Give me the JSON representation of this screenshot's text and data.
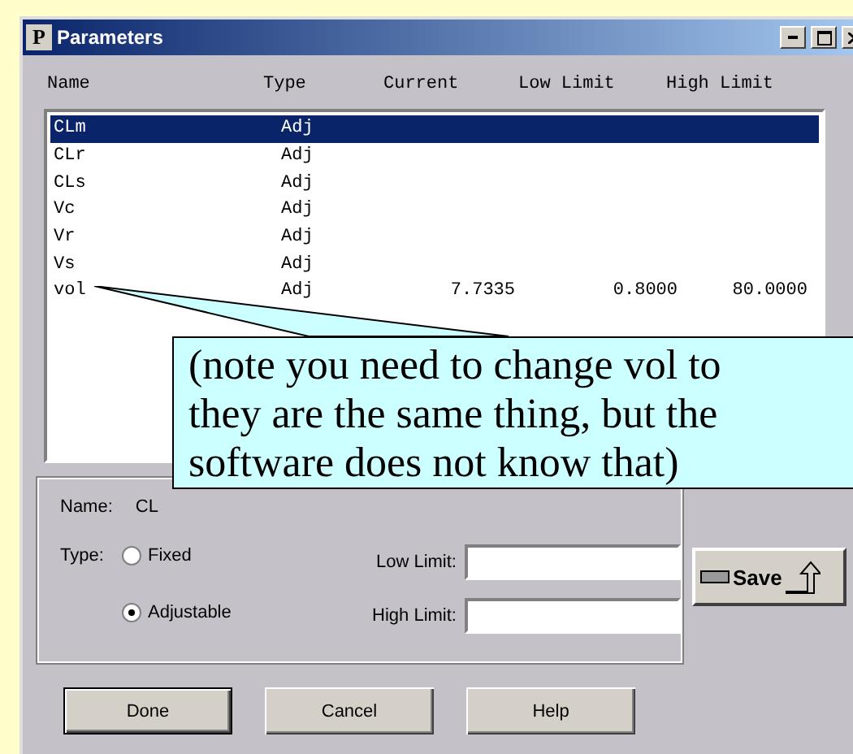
{
  "window": {
    "title": "Parameters",
    "icon_letter": "P"
  },
  "columns": [
    "Name",
    "Type",
    "Current",
    "Low Limit",
    "High Limit"
  ],
  "rows": [
    {
      "cells": [
        "CLm",
        "Adj",
        "",
        "",
        ""
      ],
      "selected": true
    },
    {
      "cells": [
        "CLr",
        "Adj",
        "",
        "",
        ""
      ],
      "selected": false
    },
    {
      "cells": [
        "CLs",
        "Adj",
        "",
        "",
        ""
      ],
      "selected": false
    },
    {
      "cells": [
        "Vc",
        "Adj",
        "",
        "",
        ""
      ],
      "selected": false
    },
    {
      "cells": [
        "Vr",
        "Adj",
        "",
        "",
        ""
      ],
      "selected": false
    },
    {
      "cells": [
        "Vs",
        "Adj",
        "",
        "",
        ""
      ],
      "selected": false
    },
    {
      "cells": [
        "vol",
        "Adj",
        "7.7335",
        "0.8000",
        "80.0000"
      ],
      "selected": false
    }
  ],
  "details": {
    "name_label": "Name:",
    "name_value": "CL",
    "type_label": "Type:",
    "types": [
      {
        "label": "Fixed",
        "selected": false
      },
      {
        "label": "Adjustable",
        "selected": true
      }
    ],
    "low_limit_label": "Low Limit:",
    "high_limit_label": "High Limit:",
    "save": "Save"
  },
  "buttons": [
    {
      "label": "Done",
      "default": true
    },
    {
      "label": "Cancel",
      "default": false
    },
    {
      "label": "Help",
      "default": false
    }
  ],
  "callout": [
    "(note you need to change vol to",
    "they are the same thing, but the",
    "software does not know that)"
  ]
}
